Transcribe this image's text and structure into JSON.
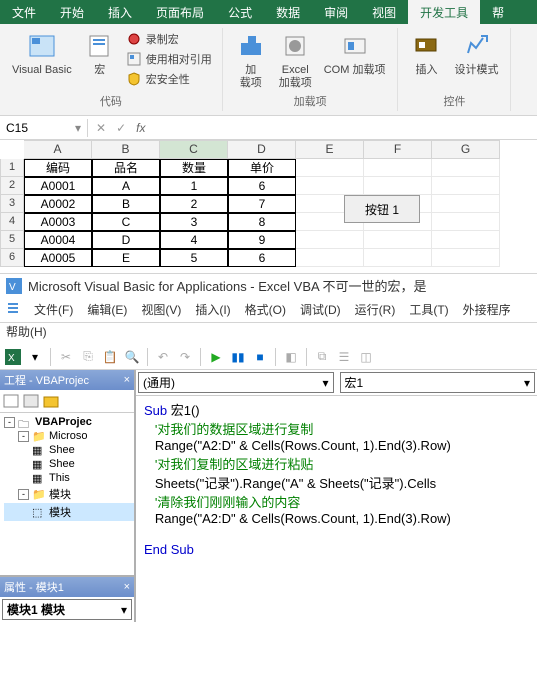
{
  "ribbon_tabs": [
    "文件",
    "开始",
    "插入",
    "页面布局",
    "公式",
    "数据",
    "审阅",
    "视图",
    "开发工具",
    "帮"
  ],
  "active_tab_index": 8,
  "ribbon": {
    "code_group": {
      "visual_basic": "Visual Basic",
      "macros": "宏",
      "record_macro": "录制宏",
      "use_relative": "使用相对引用",
      "macro_security": "宏安全性",
      "label": "代码"
    },
    "addins_group": {
      "addins": "加\n载项",
      "excel_addins": "Excel\n加载项",
      "com_addins": "COM 加载项",
      "label": "加载项"
    },
    "controls_group": {
      "insert": "插入",
      "design_mode": "设计模式",
      "label": "控件"
    }
  },
  "name_box": "C15",
  "fx_label": "fx",
  "columns": [
    "A",
    "B",
    "C",
    "D",
    "E",
    "F",
    "G"
  ],
  "selected_col_index": 2,
  "row_numbers": [
    "1",
    "2",
    "3",
    "4",
    "5",
    "6"
  ],
  "table": {
    "headers": [
      "编码",
      "品名",
      "数量",
      "单价"
    ],
    "rows": [
      [
        "A0001",
        "A",
        "1",
        "6"
      ],
      [
        "A0002",
        "B",
        "2",
        "7"
      ],
      [
        "A0003",
        "C",
        "3",
        "8"
      ],
      [
        "A0004",
        "D",
        "4",
        "9"
      ],
      [
        "A0005",
        "E",
        "5",
        "6"
      ]
    ]
  },
  "button1_label": "按钮 1",
  "vba": {
    "title": "Microsoft Visual Basic for Applications - Excel VBA 不可一世的宏，是",
    "menus": {
      "file": "文件(F)",
      "edit": "编辑(E)",
      "view": "视图(V)",
      "insert": "插入(I)",
      "format": "格式(O)",
      "debug": "调试(D)",
      "run": "运行(R)",
      "tools": "工具(T)",
      "addins": "外接程序",
      "help": "帮助(H)"
    },
    "project_panel_title": "工程 - VBAProjec",
    "tree": {
      "root": "VBAProjec",
      "ms_objects": "Microso",
      "sheet1": "Shee",
      "sheet2": "Shee",
      "thisworkbook": "This",
      "modules": "模块",
      "module1": "模块"
    },
    "props_title": "属性 - 模块1",
    "props_row": "模块1 模块",
    "code_dropdown_left": "(通用)",
    "code_dropdown_right": "宏1",
    "code": {
      "l1_kw": "Sub ",
      "l1_name": "宏1()",
      "l2": "   '对我们的数据区域进行复制",
      "l3": "   Range(\"A2:D\" & Cells(Rows.Count, 1).End(3).Row)",
      "l4": "   '对我们复制的区域进行粘贴",
      "l5": "   Sheets(\"记录\").Range(\"A\" & Sheets(\"记录\").Cells",
      "l6": "   '清除我们刚刚输入的内容",
      "l7": "   Range(\"A2:D\" & Cells(Rows.Count, 1).End(3).Row)",
      "l8_kw": "End Sub"
    }
  }
}
